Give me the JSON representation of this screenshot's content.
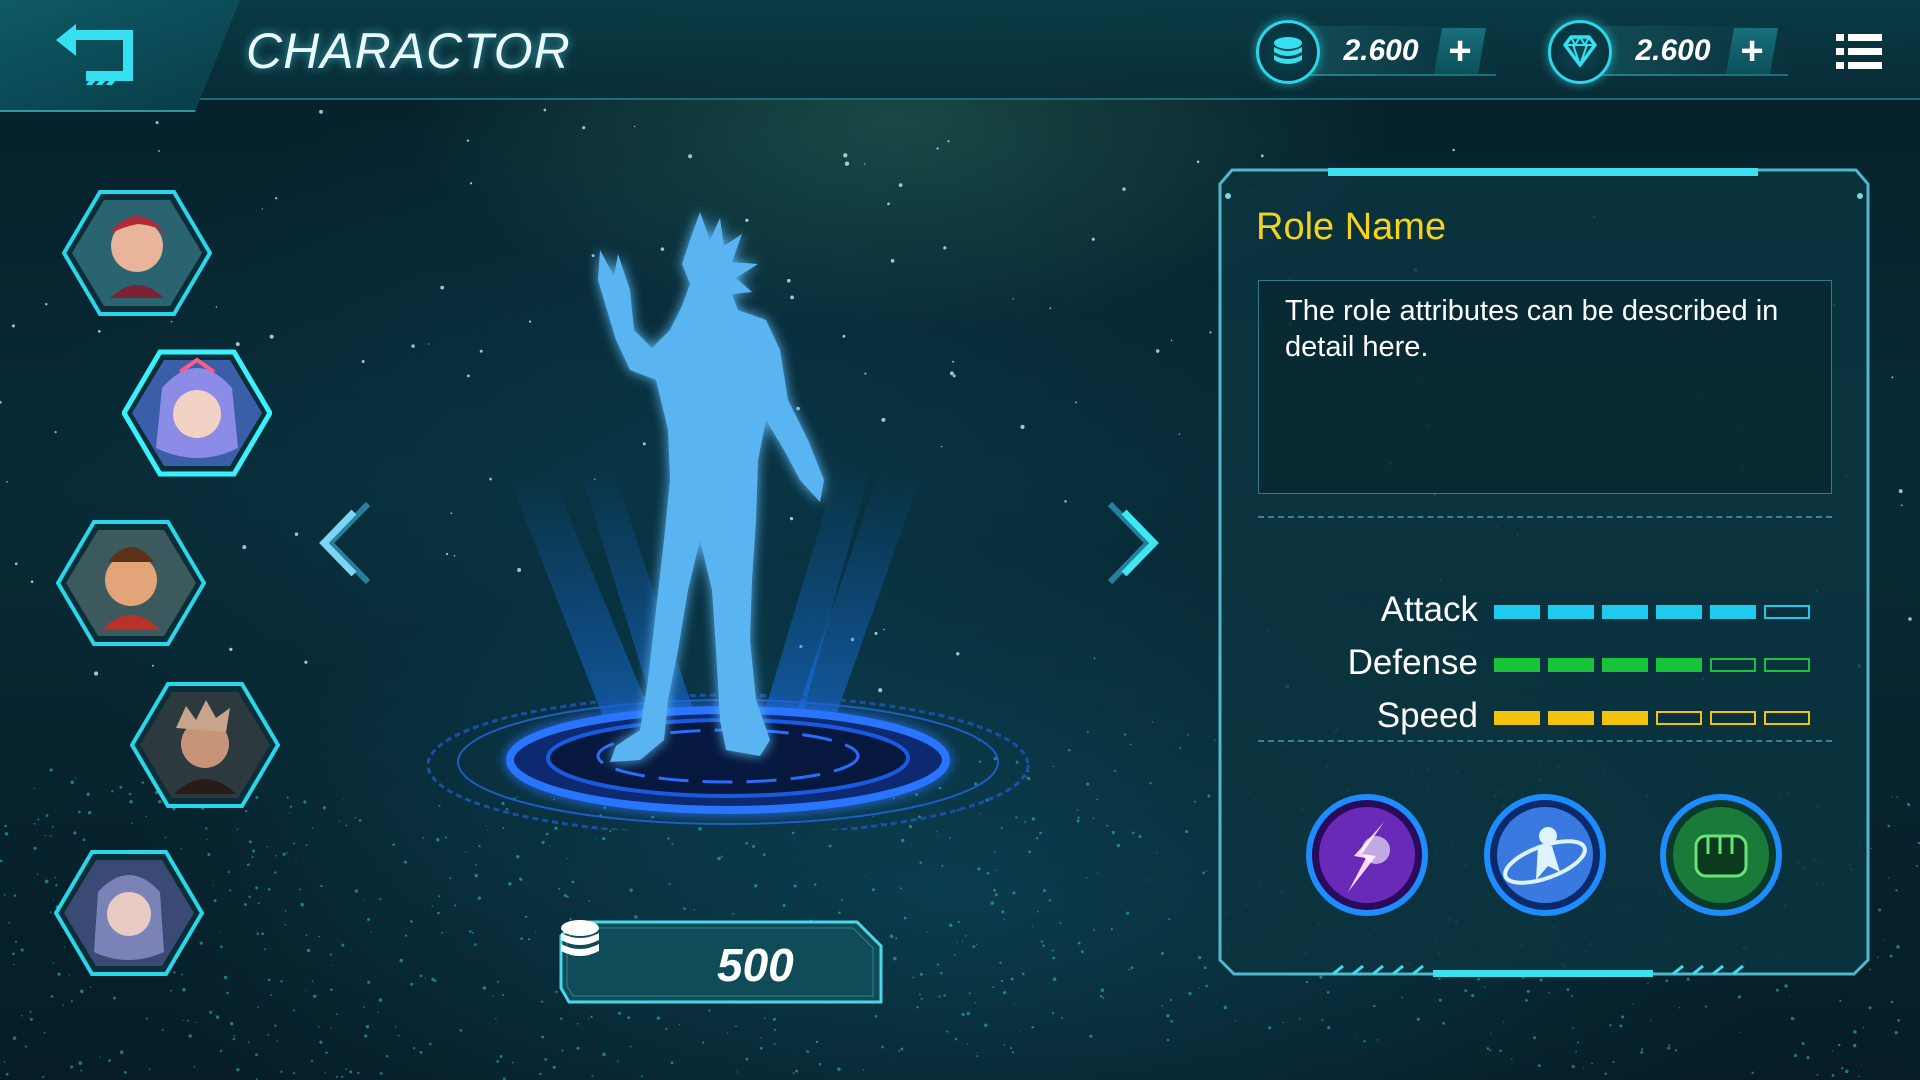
{
  "header": {
    "title": "CHARACTOR",
    "back_icon": "back-arrow-icon",
    "menu_icon": "list-menu-icon"
  },
  "currencies": [
    {
      "icon": "coin-stack-icon",
      "value": "2.600",
      "add_label": "+"
    },
    {
      "icon": "diamond-icon",
      "value": "2.600",
      "add_label": "+"
    }
  ],
  "roster": [
    {
      "name": "red-haired hero portrait"
    },
    {
      "name": "blue-haired heroine portrait",
      "selected": true
    },
    {
      "name": "topknot hero portrait"
    },
    {
      "name": "spiky-haired hero portrait"
    },
    {
      "name": "crowned heroine portrait"
    }
  ],
  "hero": {
    "icon": "hologram-silhouette",
    "prev_icon": "chevron-left-icon",
    "next_icon": "chevron-right-icon"
  },
  "price": {
    "icon": "coin-stack-icon",
    "value": "500"
  },
  "panel": {
    "role_name": "Role Name",
    "description": "The role attributes can be described in detail here.",
    "stats": [
      {
        "label": "Attack",
        "level": 5,
        "max": 6,
        "color": "#1ecbef"
      },
      {
        "label": "Defense",
        "level": 4,
        "max": 6,
        "color": "#17c43a"
      },
      {
        "label": "Speed",
        "level": 3,
        "max": 6,
        "color": "#f2c20d"
      }
    ],
    "skills": [
      {
        "icon": "lightning-strike-skill-icon"
      },
      {
        "icon": "orbit-dash-skill-icon"
      },
      {
        "icon": "fist-skill-icon"
      }
    ]
  },
  "colors": {
    "accent": "#2ad6ea",
    "title_yellow": "#f6d21a",
    "panel_bg": "#0b3440"
  }
}
